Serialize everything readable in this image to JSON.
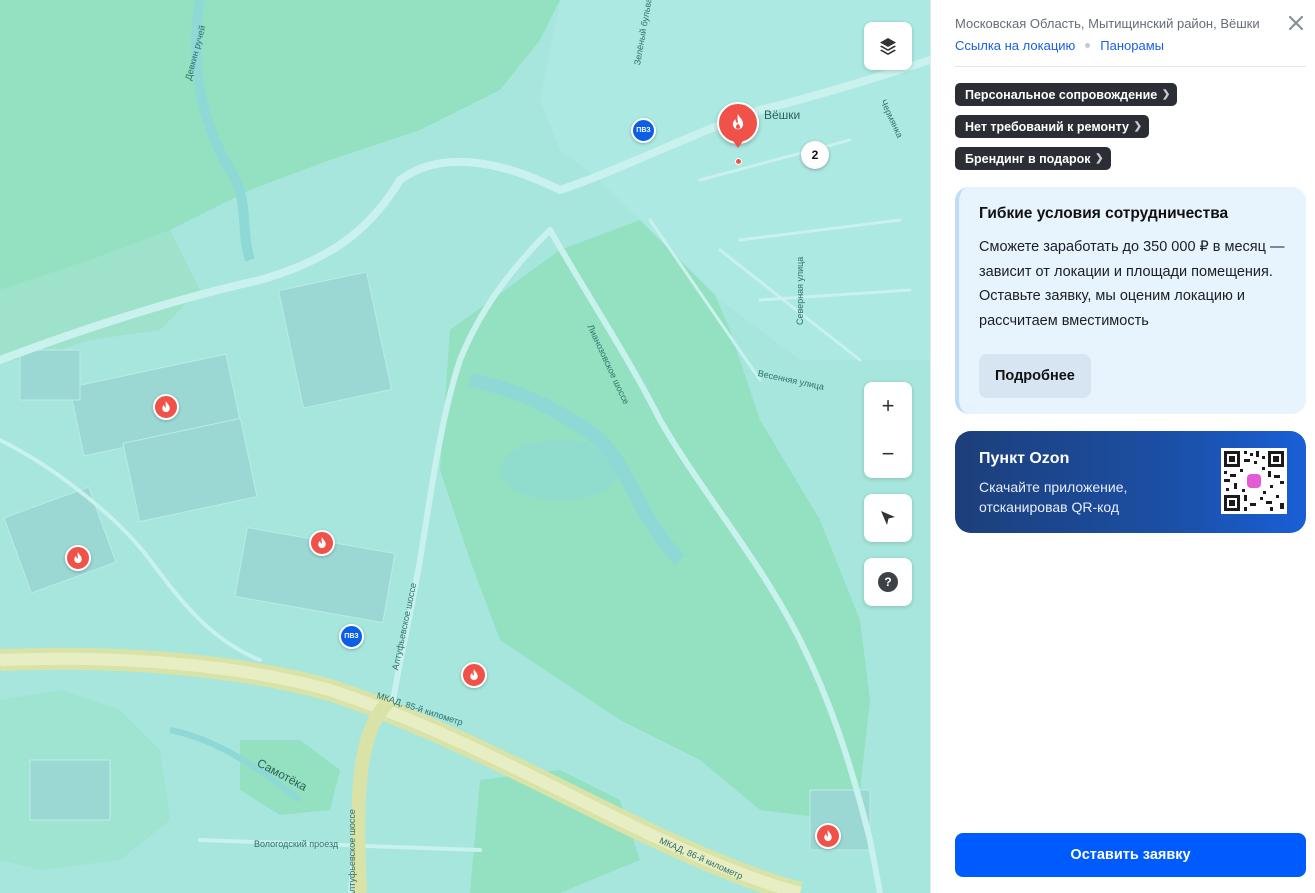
{
  "map": {
    "labels": {
      "veshki": "Вёшки",
      "lianozovskoe": "Лианозовское шоссе",
      "severnaya": "Северная улица",
      "vesennyaya": "Весенняя улица",
      "altufyevskoe": "Алтуфьевское шоссе",
      "mkad85": "МКАД, 85-й километр",
      "mkad86": "МКАД, 86-й километр",
      "samotyoka": "Самотёка",
      "vologodsky": "Вологодский проезд",
      "zelyony": "Зелёный бульвар",
      "chermyanka": "Чермянка",
      "devkin": "Девкин ручей",
      "altufyevskoe_2": "Алтуфьевское шоссе"
    },
    "pvz_label": "ПВЗ",
    "cluster_count": "2",
    "zoom_in": "+",
    "zoom_out": "−",
    "help": "?",
    "colors": {
      "fire": "#f05249",
      "pvz": "#0b5fe6",
      "forest": "#93e1c1",
      "water_base": "#a6e6dc"
    }
  },
  "panel": {
    "address": "Московская Область, Мытищинский район, Вёшки",
    "link_location": "Ссылка на локацию",
    "link_panorama": "Панорамы",
    "tags": [
      "Персональное сопровождение",
      "Нет требований к ремонту",
      "Брендинг в подарок"
    ],
    "promo": {
      "title": "Гибкие условия сотрудничества",
      "text": "Сможете заработать до 350 000 ₽ в месяц — зависит от локации и площади помещения. Оставьте заявку, мы оценим локацию и рассчитаем вместимость",
      "button": "Подробнее"
    },
    "qr_card": {
      "title": "Пункт Ozon",
      "subtitle": "Скачайте приложение, отсканировав QR-код"
    },
    "submit": "Оставить заявку",
    "accent": "#005bff"
  }
}
